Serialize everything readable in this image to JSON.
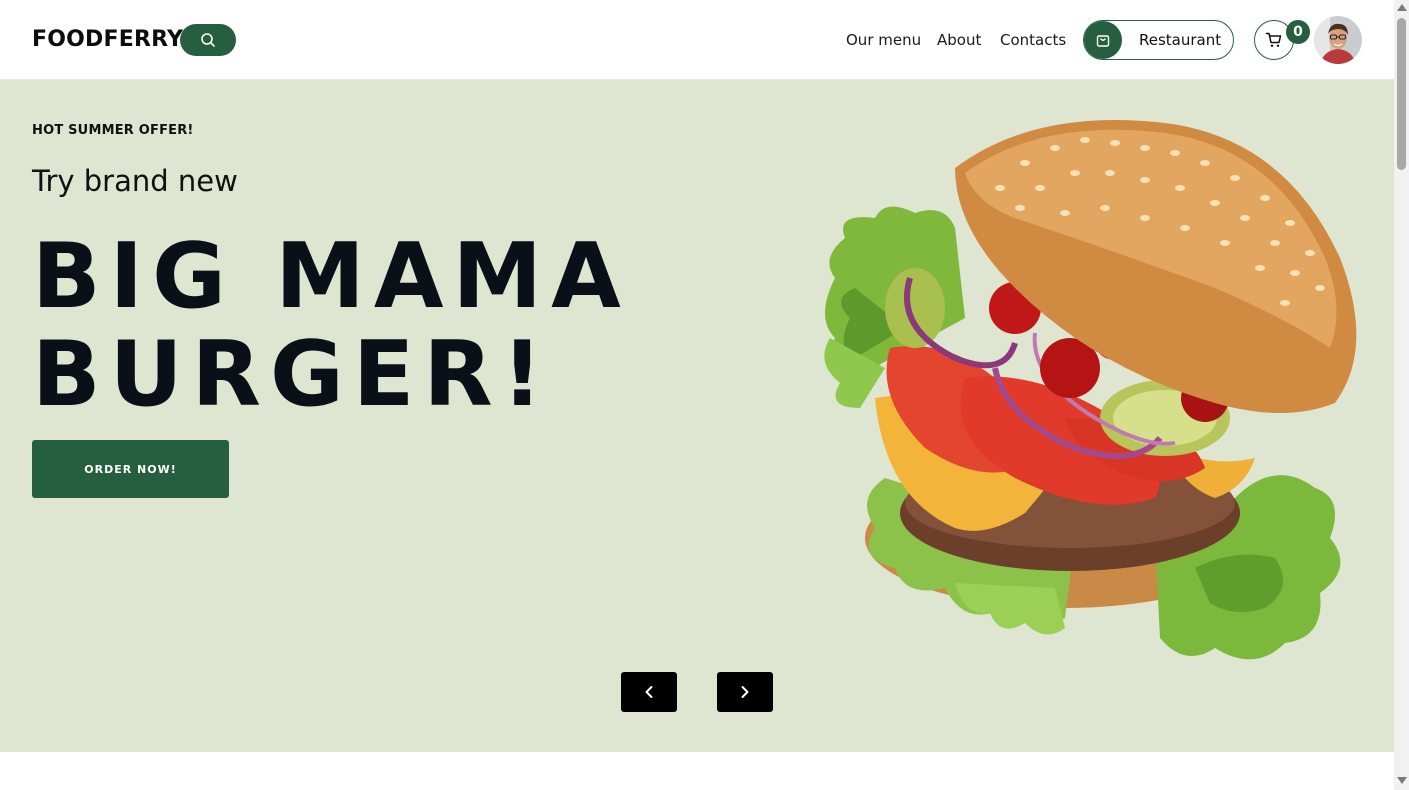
{
  "header": {
    "logo": "FOODFERRY",
    "nav": [
      "Our menu",
      "About",
      "Contacts"
    ],
    "restaurant_label": "Restaurant",
    "cart_count": "0"
  },
  "hero": {
    "eyebrow": "HOT SUMMER OFFER!",
    "subtitle": "Try brand new",
    "headline_line1": "BIG MAMA",
    "headline_line2": "BURGER!",
    "cta": "ORDER NOW!"
  },
  "colors": {
    "brand_green": "#255f3f",
    "hero_bg": "#dee6d1",
    "arrow_bg": "#000000"
  },
  "icons": [
    "search-icon",
    "shopping-bag-icon",
    "cart-icon",
    "chevron-left-icon",
    "chevron-right-icon"
  ]
}
